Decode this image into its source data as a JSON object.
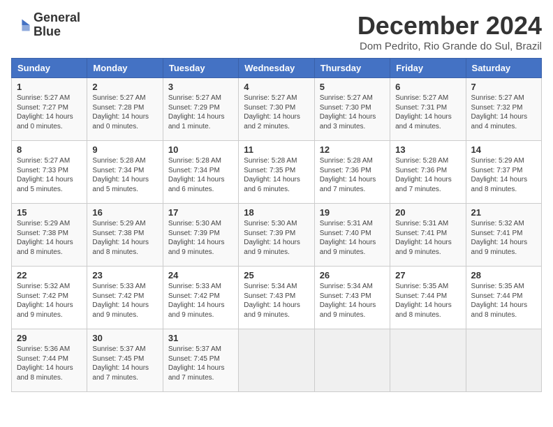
{
  "logo": {
    "line1": "General",
    "line2": "Blue"
  },
  "title": "December 2024",
  "location": "Dom Pedrito, Rio Grande do Sul, Brazil",
  "days_of_week": [
    "Sunday",
    "Monday",
    "Tuesday",
    "Wednesday",
    "Thursday",
    "Friday",
    "Saturday"
  ],
  "weeks": [
    [
      {
        "day": "1",
        "sunrise": "5:27 AM",
        "sunset": "7:27 PM",
        "daylight": "14 hours and 0 minutes."
      },
      {
        "day": "2",
        "sunrise": "5:27 AM",
        "sunset": "7:28 PM",
        "daylight": "14 hours and 0 minutes."
      },
      {
        "day": "3",
        "sunrise": "5:27 AM",
        "sunset": "7:29 PM",
        "daylight": "14 hours and 1 minute."
      },
      {
        "day": "4",
        "sunrise": "5:27 AM",
        "sunset": "7:30 PM",
        "daylight": "14 hours and 2 minutes."
      },
      {
        "day": "5",
        "sunrise": "5:27 AM",
        "sunset": "7:30 PM",
        "daylight": "14 hours and 3 minutes."
      },
      {
        "day": "6",
        "sunrise": "5:27 AM",
        "sunset": "7:31 PM",
        "daylight": "14 hours and 4 minutes."
      },
      {
        "day": "7",
        "sunrise": "5:27 AM",
        "sunset": "7:32 PM",
        "daylight": "14 hours and 4 minutes."
      }
    ],
    [
      {
        "day": "8",
        "sunrise": "5:27 AM",
        "sunset": "7:33 PM",
        "daylight": "14 hours and 5 minutes."
      },
      {
        "day": "9",
        "sunrise": "5:28 AM",
        "sunset": "7:34 PM",
        "daylight": "14 hours and 5 minutes."
      },
      {
        "day": "10",
        "sunrise": "5:28 AM",
        "sunset": "7:34 PM",
        "daylight": "14 hours and 6 minutes."
      },
      {
        "day": "11",
        "sunrise": "5:28 AM",
        "sunset": "7:35 PM",
        "daylight": "14 hours and 6 minutes."
      },
      {
        "day": "12",
        "sunrise": "5:28 AM",
        "sunset": "7:36 PM",
        "daylight": "14 hours and 7 minutes."
      },
      {
        "day": "13",
        "sunrise": "5:28 AM",
        "sunset": "7:36 PM",
        "daylight": "14 hours and 7 minutes."
      },
      {
        "day": "14",
        "sunrise": "5:29 AM",
        "sunset": "7:37 PM",
        "daylight": "14 hours and 8 minutes."
      }
    ],
    [
      {
        "day": "15",
        "sunrise": "5:29 AM",
        "sunset": "7:38 PM",
        "daylight": "14 hours and 8 minutes."
      },
      {
        "day": "16",
        "sunrise": "5:29 AM",
        "sunset": "7:38 PM",
        "daylight": "14 hours and 8 minutes."
      },
      {
        "day": "17",
        "sunrise": "5:30 AM",
        "sunset": "7:39 PM",
        "daylight": "14 hours and 9 minutes."
      },
      {
        "day": "18",
        "sunrise": "5:30 AM",
        "sunset": "7:39 PM",
        "daylight": "14 hours and 9 minutes."
      },
      {
        "day": "19",
        "sunrise": "5:31 AM",
        "sunset": "7:40 PM",
        "daylight": "14 hours and 9 minutes."
      },
      {
        "day": "20",
        "sunrise": "5:31 AM",
        "sunset": "7:41 PM",
        "daylight": "14 hours and 9 minutes."
      },
      {
        "day": "21",
        "sunrise": "5:32 AM",
        "sunset": "7:41 PM",
        "daylight": "14 hours and 9 minutes."
      }
    ],
    [
      {
        "day": "22",
        "sunrise": "5:32 AM",
        "sunset": "7:42 PM",
        "daylight": "14 hours and 9 minutes."
      },
      {
        "day": "23",
        "sunrise": "5:33 AM",
        "sunset": "7:42 PM",
        "daylight": "14 hours and 9 minutes."
      },
      {
        "day": "24",
        "sunrise": "5:33 AM",
        "sunset": "7:42 PM",
        "daylight": "14 hours and 9 minutes."
      },
      {
        "day": "25",
        "sunrise": "5:34 AM",
        "sunset": "7:43 PM",
        "daylight": "14 hours and 9 minutes."
      },
      {
        "day": "26",
        "sunrise": "5:34 AM",
        "sunset": "7:43 PM",
        "daylight": "14 hours and 9 minutes."
      },
      {
        "day": "27",
        "sunrise": "5:35 AM",
        "sunset": "7:44 PM",
        "daylight": "14 hours and 8 minutes."
      },
      {
        "day": "28",
        "sunrise": "5:35 AM",
        "sunset": "7:44 PM",
        "daylight": "14 hours and 8 minutes."
      }
    ],
    [
      {
        "day": "29",
        "sunrise": "5:36 AM",
        "sunset": "7:44 PM",
        "daylight": "14 hours and 8 minutes."
      },
      {
        "day": "30",
        "sunrise": "5:37 AM",
        "sunset": "7:45 PM",
        "daylight": "14 hours and 7 minutes."
      },
      {
        "day": "31",
        "sunrise": "5:37 AM",
        "sunset": "7:45 PM",
        "daylight": "14 hours and 7 minutes."
      },
      null,
      null,
      null,
      null
    ]
  ]
}
